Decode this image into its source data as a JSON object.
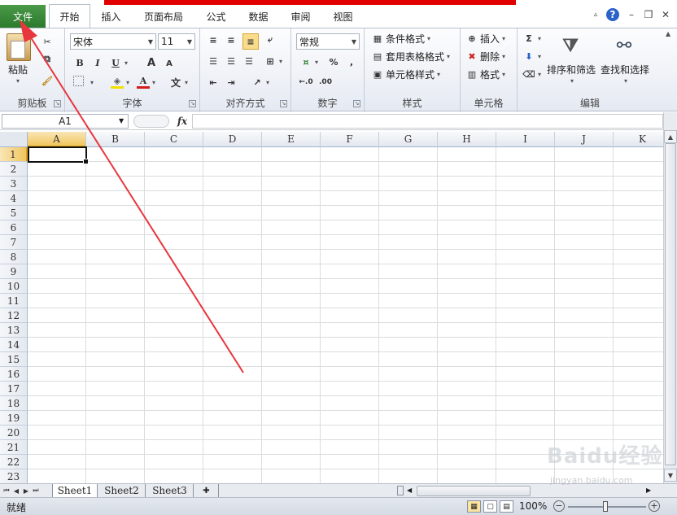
{
  "tabs": {
    "file": "文件",
    "home": "开始",
    "insert": "插入",
    "page_layout": "页面布局",
    "formulas": "公式",
    "data": "数据",
    "review": "审阅",
    "view": "视图"
  },
  "ribbon": {
    "clipboard": {
      "paste": "粘贴",
      "label": "剪贴板"
    },
    "font": {
      "name": "宋体",
      "size": "11",
      "label": "字体",
      "bold": "B",
      "italic": "I",
      "underline": "U",
      "grow": "A",
      "shrink": "A",
      "color": "A",
      "phonetic": "文"
    },
    "alignment": {
      "label": "对齐方式"
    },
    "number": {
      "format": "常规",
      "percent": "%",
      "comma": ",",
      "label": "数字"
    },
    "styles": {
      "conditional": "条件格式",
      "table": "套用表格格式",
      "cell_styles": "单元格样式",
      "label": "样式"
    },
    "cells": {
      "insert": "插入",
      "delete": "删除",
      "format": "格式",
      "label": "单元格"
    },
    "editing": {
      "sum": "Σ",
      "sort_filter": "排序和筛选",
      "find_select": "查找和选择",
      "label": "编辑"
    }
  },
  "formula_bar": {
    "name_box": "A1",
    "fx": "fx",
    "content": ""
  },
  "columns": [
    "A",
    "B",
    "C",
    "D",
    "E",
    "F",
    "G",
    "H",
    "I",
    "J",
    "K"
  ],
  "rows": [
    "1",
    "2",
    "3",
    "4",
    "5",
    "6",
    "7",
    "8",
    "9",
    "10",
    "11",
    "12",
    "13",
    "14",
    "15",
    "16",
    "17",
    "18",
    "19",
    "20",
    "21",
    "22",
    "23"
  ],
  "sheets": [
    "Sheet1",
    "Sheet2",
    "Sheet3"
  ],
  "status": {
    "ready": "就绪",
    "zoom": "100%"
  },
  "watermark": {
    "main": "Baidu经验",
    "sub": "jingyan.baidu.com"
  },
  "colors": {
    "file_tab": "#2c7a2c",
    "arrow": "#e8363e",
    "highlight": "#f1c55e"
  }
}
